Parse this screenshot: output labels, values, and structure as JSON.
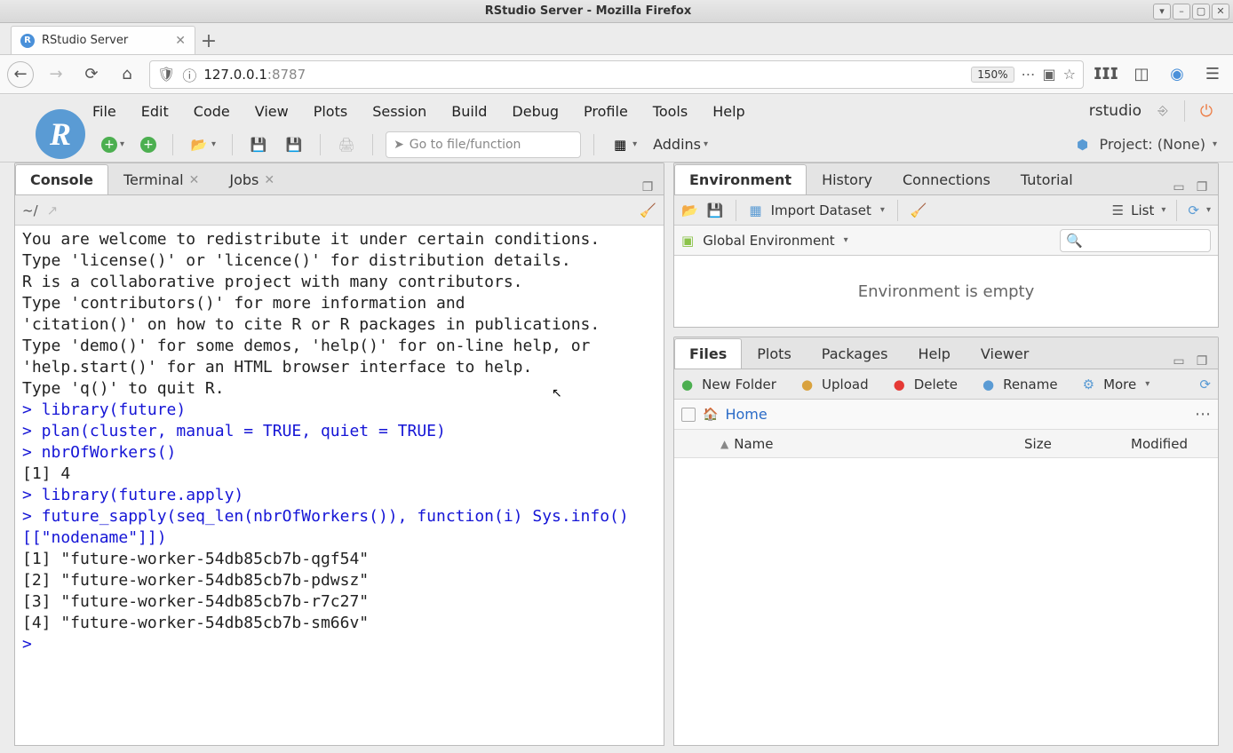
{
  "window": {
    "title": "RStudio Server - Mozilla Firefox"
  },
  "browser": {
    "tab_title": "RStudio Server",
    "url_ip": "127.0.0.1",
    "url_port": ":8787",
    "zoom": "150%"
  },
  "menubar": {
    "items": [
      "File",
      "Edit",
      "Code",
      "View",
      "Plots",
      "Session",
      "Build",
      "Debug",
      "Profile",
      "Tools",
      "Help"
    ],
    "user": "rstudio"
  },
  "toolbar": {
    "goto_placeholder": "Go to file/function",
    "addins": "Addins",
    "project_label": "Project: (None)"
  },
  "left_tabs": {
    "console": "Console",
    "terminal": "Terminal",
    "jobs": "Jobs"
  },
  "console": {
    "path": "~/",
    "lines": [
      {
        "t": "out",
        "s": "You are welcome to redistribute it under certain conditions."
      },
      {
        "t": "out",
        "s": "Type 'license()' or 'licence()' for distribution details."
      },
      {
        "t": "out",
        "s": ""
      },
      {
        "t": "out",
        "s": "R is a collaborative project with many contributors."
      },
      {
        "t": "out",
        "s": "Type 'contributors()' for more information and"
      },
      {
        "t": "out",
        "s": "'citation()' on how to cite R or R packages in publications."
      },
      {
        "t": "out",
        "s": ""
      },
      {
        "t": "out",
        "s": "Type 'demo()' for some demos, 'help()' for on-line help, or"
      },
      {
        "t": "out",
        "s": "'help.start()' for an HTML browser interface to help."
      },
      {
        "t": "out",
        "s": "Type 'q()' to quit R."
      },
      {
        "t": "out",
        "s": ""
      },
      {
        "t": "in",
        "s": "> library(future)"
      },
      {
        "t": "in",
        "s": "> plan(cluster, manual = TRUE, quiet = TRUE)"
      },
      {
        "t": "in",
        "s": "> nbrOfWorkers()"
      },
      {
        "t": "out",
        "s": "[1] 4"
      },
      {
        "t": "in",
        "s": "> library(future.apply)"
      },
      {
        "t": "in",
        "s": "> future_sapply(seq_len(nbrOfWorkers()), function(i) Sys.info()[[\"nodename\"]])"
      },
      {
        "t": "out",
        "s": "[1] \"future-worker-54db85cb7b-qgf54\""
      },
      {
        "t": "out",
        "s": "[2] \"future-worker-54db85cb7b-pdwsz\""
      },
      {
        "t": "out",
        "s": "[3] \"future-worker-54db85cb7b-r7c27\""
      },
      {
        "t": "out",
        "s": "[4] \"future-worker-54db85cb7b-sm66v\""
      },
      {
        "t": "in",
        "s": "> "
      }
    ]
  },
  "env_panel": {
    "tabs": [
      "Environment",
      "History",
      "Connections",
      "Tutorial"
    ],
    "import": "Import Dataset",
    "list": "List",
    "scope": "Global Environment",
    "empty": "Environment is empty"
  },
  "files_panel": {
    "tabs": [
      "Files",
      "Plots",
      "Packages",
      "Help",
      "Viewer"
    ],
    "btns": {
      "newfolder": "New Folder",
      "upload": "Upload",
      "delete": "Delete",
      "rename": "Rename",
      "more": "More"
    },
    "breadcrumb": "Home",
    "cols": {
      "name": "Name",
      "size": "Size",
      "modified": "Modified"
    }
  }
}
